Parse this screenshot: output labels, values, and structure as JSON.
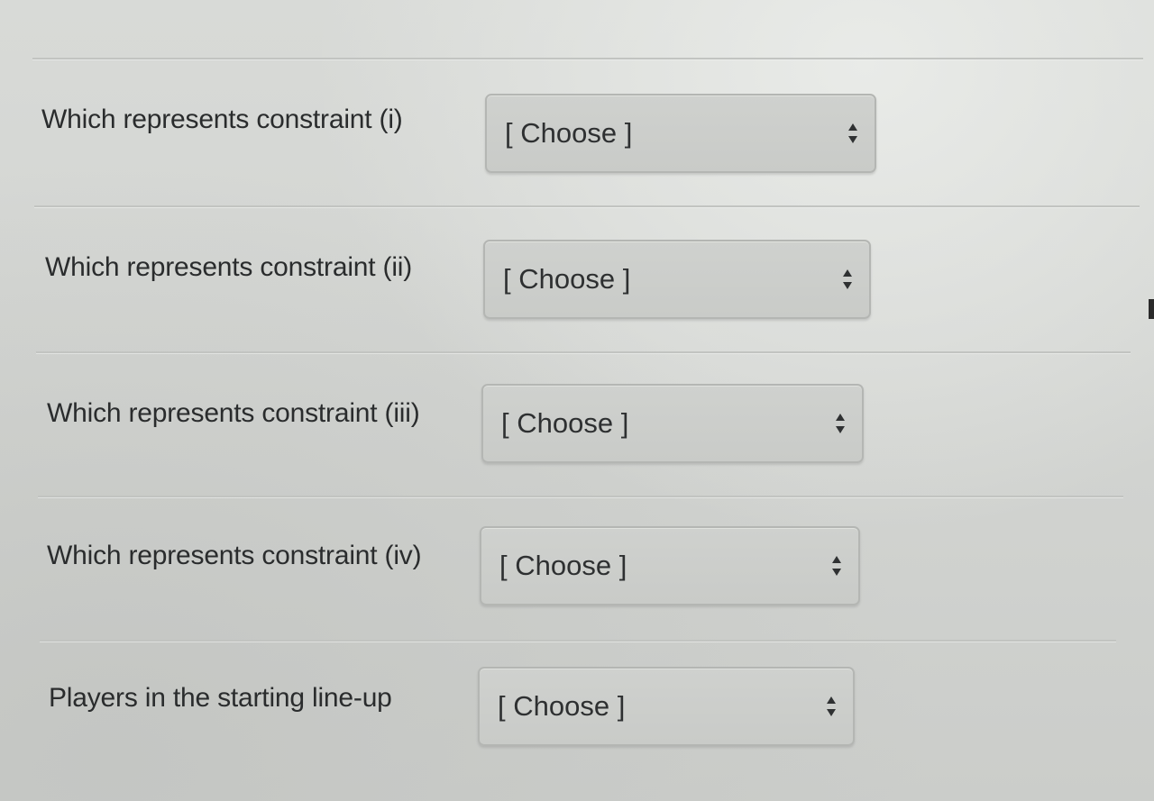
{
  "questions": [
    {
      "label": "Which represents constraint (i)",
      "selected": "[ Choose ]"
    },
    {
      "label": "Which represents constraint (ii)",
      "selected": "[ Choose ]"
    },
    {
      "label": "Which represents constraint (iii)",
      "selected": "[ Choose ]"
    },
    {
      "label": "Which represents constraint (iv)",
      "selected": "[ Choose ]"
    },
    {
      "label": "Players in the starting line-up",
      "selected": "[ Choose ]"
    }
  ],
  "icons": {
    "select_arrows": "up-down-chevron-icon"
  }
}
